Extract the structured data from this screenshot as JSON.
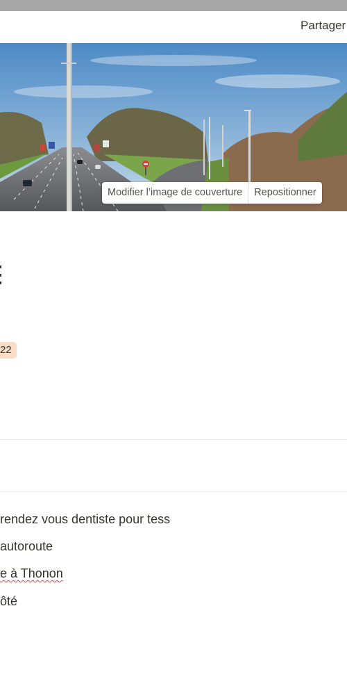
{
  "header": {
    "share_label": "Partager"
  },
  "cover": {
    "change_cover_label": "Modifier l’image de couverture",
    "reposition_label": "Repositionner"
  },
  "properties": {
    "date_tag": "22"
  },
  "content": {
    "items": [
      " rendez vous dentiste pour tess",
      "autoroute",
      "e à Thonon",
      "ôté"
    ]
  },
  "colors": {
    "tag_background": "#fbddc8",
    "text": "#37352f",
    "divider": "#e9e9e7"
  }
}
